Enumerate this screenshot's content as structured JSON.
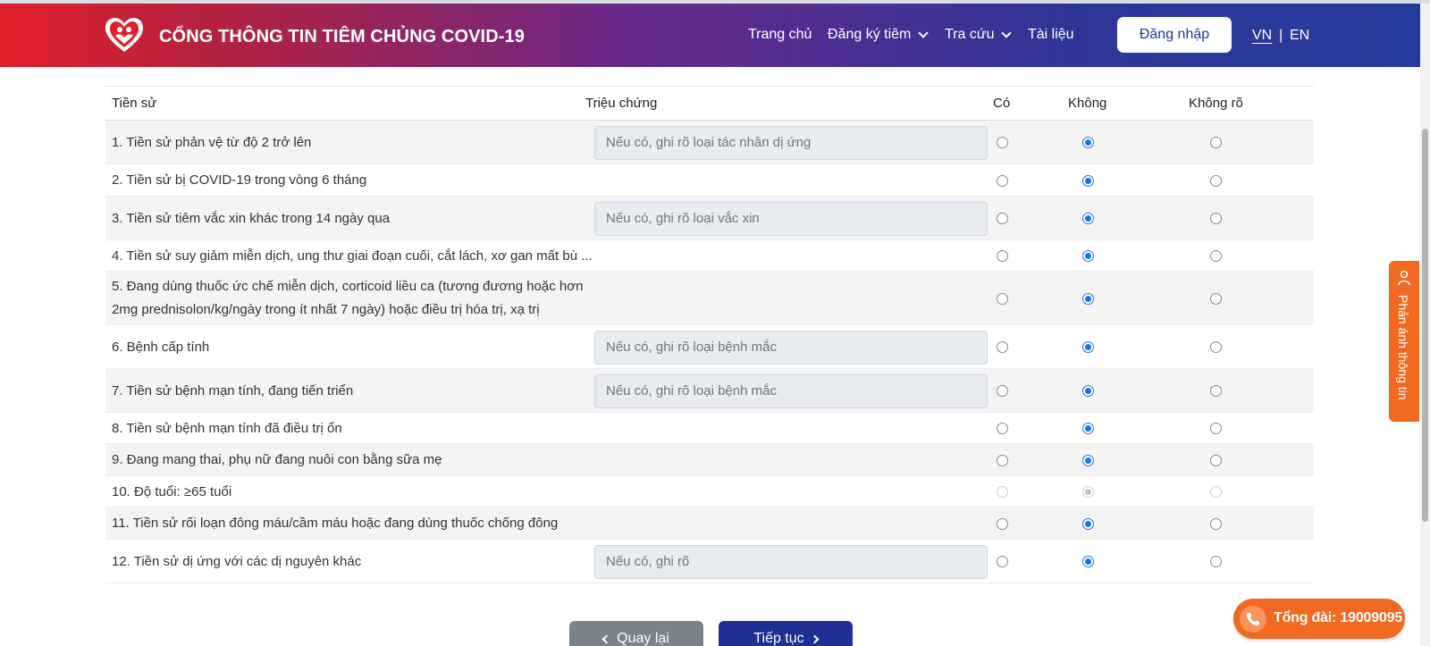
{
  "header": {
    "brand": "CỔNG THÔNG TIN TIÊM CHỦNG COVID-19",
    "nav": [
      "Trang chủ",
      "Đăng ký tiêm",
      "Tra cứu",
      "Tài liệu"
    ],
    "login_label": "Đăng nhập",
    "lang_vn": "VN",
    "lang_sep": "|",
    "lang_en": "EN"
  },
  "table": {
    "headers": [
      "Tiền sử",
      "Triệu chứng",
      "Có",
      "Không",
      "Không rõ"
    ],
    "rows": [
      {
        "label": "1. Tiền sử phản vệ từ độ 2 trở lên",
        "placeholder": "Nếu có, ghi rõ loại tác nhân dị ứng",
        "selected": "Không",
        "disabled": false
      },
      {
        "label": "2. Tiền sử bị COVID-19 trong vòng 6 tháng",
        "placeholder": null,
        "selected": "Không",
        "disabled": false
      },
      {
        "label": "3. Tiền sử tiêm vắc xin khác trong 14 ngày qua",
        "placeholder": "Nếu có, ghi rõ loại vắc xin",
        "selected": "Không",
        "disabled": false
      },
      {
        "label": "4. Tiền sử suy giảm miễn dịch, ung thư giai đoạn cuối, cắt lách, xơ gan mất bù ...",
        "placeholder": null,
        "selected": "Không",
        "disabled": false
      },
      {
        "label": "5. Đang dùng thuốc ức chế miễn dịch, corticoid liều ca (tương đương hoặc hơn 2mg prednisolon/kg/ngày trong ít nhất 7 ngày) hoặc điều trị hóa trị, xạ trị",
        "placeholder": null,
        "selected": "Không",
        "disabled": false
      },
      {
        "label": "6. Bệnh cấp tính",
        "placeholder": "Nếu có, ghi rõ loại bệnh mắc",
        "selected": "Không",
        "disabled": false
      },
      {
        "label": "7. Tiền sử bệnh mạn tính, đang tiến triển",
        "placeholder": "Nếu có, ghi rõ loại bệnh mắc",
        "selected": "Không",
        "disabled": false
      },
      {
        "label": "8. Tiền sử bệnh mạn tính đã điều trị ổn",
        "placeholder": null,
        "selected": "Không",
        "disabled": false
      },
      {
        "label": "9. Đang mang thai, phụ nữ đang nuôi con bằng sữa mẹ",
        "placeholder": null,
        "selected": "Không",
        "disabled": false
      },
      {
        "label": "10. Độ tuổi: ≥65 tuổi",
        "placeholder": null,
        "selected": "Không",
        "disabled": true
      },
      {
        "label": "11. Tiền sử rối loạn đông máu/cầm máu hoặc đang dùng thuốc chống đông",
        "placeholder": null,
        "selected": "Không",
        "disabled": false
      },
      {
        "label": "12. Tiền sử dị ứng với các dị nguyên khác",
        "placeholder": "Nếu có, ghi rõ",
        "selected": "Không",
        "disabled": false
      }
    ]
  },
  "actions": {
    "back_label": "Quay lại",
    "next_label": "Tiếp tục"
  },
  "widgets": {
    "feedback_label": "Phản ánh thông tin",
    "hotline_label": "Tổng đài: 19009095"
  },
  "colors": {
    "header_start": "#e11f2b",
    "header_end": "#263c9c",
    "primary": "#1f2f94",
    "accent_orange": "#f26a21",
    "radio_checked": "#1a73e8"
  }
}
